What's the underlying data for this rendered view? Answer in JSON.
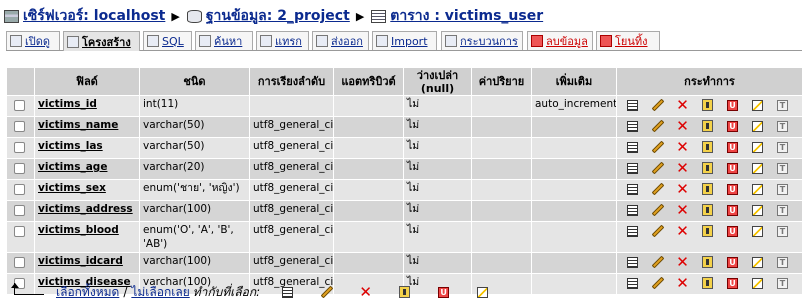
{
  "breadcrumb": {
    "server": "เซิร์ฟเวอร์: localhost",
    "database": "ฐานข้อมูล: 2_project",
    "table": "ตาราง : victims_user"
  },
  "tabs": [
    {
      "label": "เปิดดู",
      "icon": "browse-icon"
    },
    {
      "label": "โครงสร้าง",
      "icon": "structure-icon"
    },
    {
      "label": "SQL",
      "icon": "sql-icon"
    },
    {
      "label": "ค้นหา",
      "icon": "search-icon"
    },
    {
      "label": "แทรก",
      "icon": "insert-icon"
    },
    {
      "label": "ส่งออก",
      "icon": "export-icon"
    },
    {
      "label": "Import",
      "icon": "import-icon"
    },
    {
      "label": "กระบวนการ",
      "icon": "operations-icon"
    },
    {
      "label": "ลบข้อมูล",
      "icon": "empty-icon"
    },
    {
      "label": "โยนทิ้ง",
      "icon": "drop-icon"
    }
  ],
  "active_tab": "โครงสร้าง",
  "columns": [
    "ฟิลด์",
    "ชนิด",
    "การเรียงลำดับ",
    "แอตทริบิวต์",
    "ว่างเปล่า (null)",
    "ค่าปริยาย",
    "เพิ่มเติม",
    "กระทำการ"
  ],
  "rows": [
    {
      "field": "victims_id",
      "type": "int(11)",
      "collation": "",
      "attributes": "",
      "null": "ไม่",
      "default": "",
      "extra": "auto_increment"
    },
    {
      "field": "victims_name",
      "type": "varchar(50)",
      "collation": "utf8_general_ci",
      "attributes": "",
      "null": "ไม่",
      "default": "",
      "extra": ""
    },
    {
      "field": "victims_las",
      "type": "varchar(50)",
      "collation": "utf8_general_ci",
      "attributes": "",
      "null": "ไม่",
      "default": "",
      "extra": ""
    },
    {
      "field": "victims_age",
      "type": "varchar(20)",
      "collation": "utf8_general_ci",
      "attributes": "",
      "null": "ไม่",
      "default": "",
      "extra": ""
    },
    {
      "field": "victims_sex",
      "type": "enum('ชาย', 'หญิง')",
      "collation": "utf8_general_ci",
      "attributes": "",
      "null": "ไม่",
      "default": "",
      "extra": ""
    },
    {
      "field": "victims_address",
      "type": "varchar(100)",
      "collation": "utf8_general_ci",
      "attributes": "",
      "null": "ไม่",
      "default": "",
      "extra": ""
    },
    {
      "field": "victims_blood",
      "type": "enum('O', 'A', 'B', 'AB')",
      "collation": "utf8_general_ci",
      "attributes": "",
      "null": "ไม่",
      "default": "",
      "extra": ""
    },
    {
      "field": "victims_idcard",
      "type": "varchar(100)",
      "collation": "utf8_general_ci",
      "attributes": "",
      "null": "ไม่",
      "default": "",
      "extra": ""
    },
    {
      "field": "victims_disease",
      "type": "varchar(100)",
      "collation": "utf8_general_ci",
      "attributes": "",
      "null": "ไม่",
      "default": "",
      "extra": ""
    }
  ],
  "row_actions": [
    "browse-icon",
    "edit-icon",
    "drop-icon",
    "primary-key-icon",
    "unique-icon",
    "index-icon",
    "fulltext-icon"
  ],
  "bottom": {
    "check_all": "เลือกทั้งหมด",
    "separator": "/",
    "uncheck_all": "ไม่เลือกเลย",
    "with_selected": "ทำกับที่เลือก:",
    "actions": [
      "browse-icon",
      "edit-icon",
      "drop-icon",
      "primary-key-icon",
      "unique-icon",
      "index-icon"
    ]
  },
  "colors": {
    "link": "#0b2a8f",
    "header_bg": "#d0d0d0",
    "row_odd": "#e5e5e5",
    "row_even": "#d5d5d5",
    "drop": "#dd0000"
  }
}
